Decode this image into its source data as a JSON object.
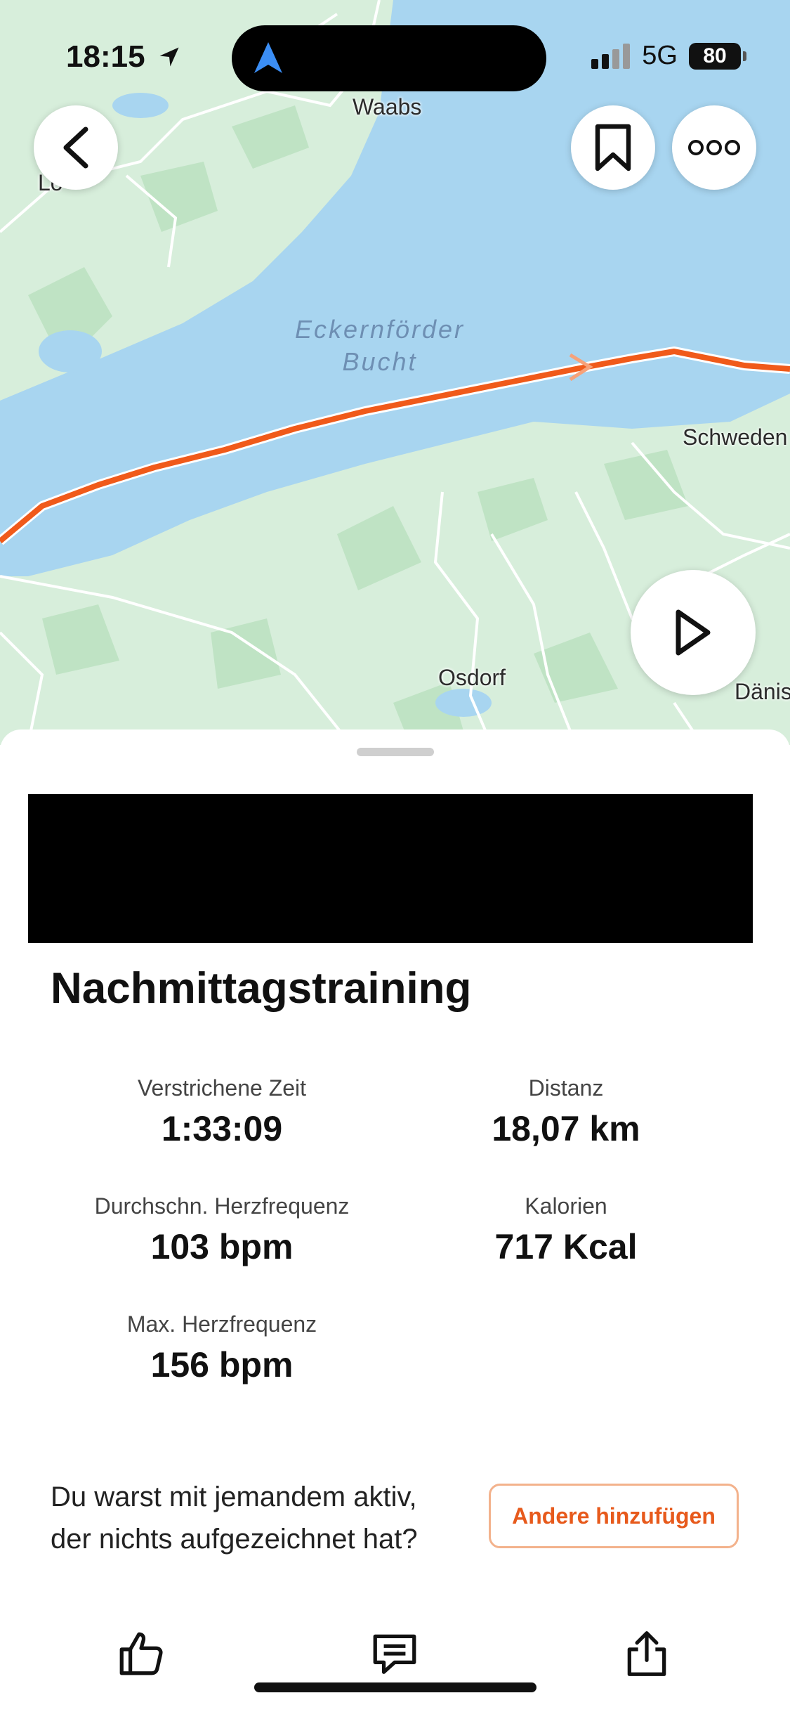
{
  "status_bar": {
    "time": "18:15",
    "network": "5G",
    "battery": "80"
  },
  "map": {
    "places": {
      "waabs": "Waabs",
      "schwedeneck": "Schweden",
      "osdorf": "Osdorf",
      "daenischenhagen": "Dänis",
      "loose": "Lo   "
    },
    "water_name": {
      "line1": "Eckernförder",
      "line2": "Bucht"
    },
    "route_color": "#f05a1a",
    "icons": [
      "back-arrow-icon",
      "bookmark-icon",
      "more-dots-icon",
      "play-icon"
    ]
  },
  "activity": {
    "title": "Nachmittagstraining",
    "stats": {
      "elapsed_time": {
        "label": "Verstrichene Zeit",
        "value": "1:33:09"
      },
      "distance": {
        "label": "Distanz",
        "value": "18,07 km"
      },
      "avg_heart_rate": {
        "label": "Durchschn. Herzfrequenz",
        "value": "103 bpm"
      },
      "calories": {
        "label": "Kalorien",
        "value": "717 Kcal"
      },
      "max_heart_rate": {
        "label": "Max. Herzfrequenz",
        "value": "156 bpm"
      }
    }
  },
  "partner_prompt": {
    "line1": "Du warst mit jemandem aktiv,",
    "line2": "der nichts aufgezeichnet hat?",
    "button": "Andere hinzufügen"
  },
  "bottom_actions": [
    "thumbs-up-icon",
    "comment-icon",
    "share-icon"
  ],
  "colors": {
    "accent": "#e75a1c",
    "water": "#a8d5f0",
    "land": "#d7eedb"
  }
}
